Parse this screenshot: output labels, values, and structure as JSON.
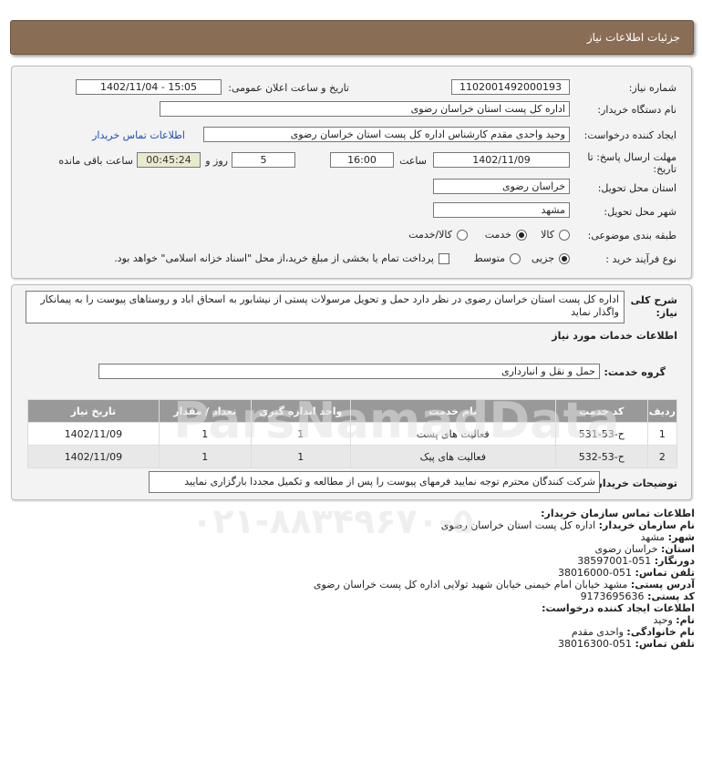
{
  "header": {
    "title": "جزئیات اطلاعات نیاز"
  },
  "fields": {
    "need_number_label": "شماره نیاز:",
    "need_number": "1102001492000193",
    "announce_label": "تاریخ و ساعت اعلان عمومی:",
    "announce_value": "1402/11/04 - 15:05",
    "buyer_label": "نام دستگاه خریدار:",
    "buyer_value": "اداره کل پست استان خراسان رضوی",
    "creator_label": "ایجاد کننده درخواست:",
    "creator_value": "وحید واحدی مقدم کارشناس اداره کل پست استان خراسان رضوی",
    "contact_link": "اطلاعات تماس خریدار",
    "deadline_label_1": "مهلت ارسال پاسخ: تا",
    "deadline_label_2": "تاریخ:",
    "deadline_date": "1402/11/09",
    "time_label": "ساعت",
    "deadline_time": "16:00",
    "days_value": "5",
    "days_label": "روز و",
    "remaining_time": "00:45:24",
    "remaining_label": "ساعت باقی مانده",
    "province_label": "استان محل تحویل:",
    "province_value": "خراسان رضوی",
    "city_label": "شهر محل تحویل:",
    "city_value": "مشهد",
    "category_label": "طبقه بندی موضوعی:",
    "cat_goods": "کالا",
    "cat_service": "خدمت",
    "cat_both": "کالا/خدمت",
    "process_label": "نوع فرآیند خرید :",
    "proc_partial": "جزیی",
    "proc_medium": "متوسط",
    "payment_note": "پرداخت تمام یا بخشی از مبلغ خرید،از محل \"اسناد خزانه اسلامی\" خواهد بود."
  },
  "summary": {
    "label_1": "شرح کلی",
    "label_2": "نیاز:",
    "text": "اداره کل پست استان خراسان رضوی در نظر دارد حمل و تحویل مرسولات پستی از نیشابور به اسحاق اباد و روستاهای پیوست را به پیمانکار واگذار نماید"
  },
  "services": {
    "section_title": "اطلاعات خدمات مورد نیاز",
    "group_label": "گروه خدمت:",
    "group_value": "حمل و نقل و انبارداری",
    "columns": [
      "ردیف",
      "کد خدمت",
      "نام خدمت",
      "واحد اندازه گیری",
      "تعداد / مقدار",
      "تاریخ نیاز"
    ],
    "rows": [
      {
        "row": "1",
        "code": "ح-53-531",
        "name": "فعالیت های پست",
        "unit": "1",
        "qty": "1",
        "date": "1402/11/09"
      },
      {
        "row": "2",
        "code": "ح-53-532",
        "name": "فعالیت های پیک",
        "unit": "1",
        "qty": "1",
        "date": "1402/11/09"
      }
    ],
    "notes_label": "توضیحات خریدار:",
    "notes_value": "شرکت کنندگان محترم توجه نمایید فرمهای پیوست را پس از مطالعه و تکمیل مجددا بارگزاری نمایید"
  },
  "contact": {
    "title": "اطلاعات تماس سازمان خریدار:",
    "org_label": "نام سازمان خریدار:",
    "org_value": "اداره کل پست استان خراسان رضوی",
    "city_label": "شهر:",
    "city_value": "مشهد",
    "province_label": "استان:",
    "province_value": "خراسان رضوی",
    "fax_label": "دورنگار:",
    "fax_value": "051-38597001",
    "phone_label": "تلفن تماس:",
    "phone_value": "051-38016000",
    "address_label": "آدرس پستی:",
    "address_value": "مشهد خیابان امام خیمنی خیابان شهید تولایی اداره کل پست خراسان رضوی",
    "postal_label": "کد پستی:",
    "postal_value": "9173695636",
    "creator_title": "اطلاعات ایجاد کننده درخواست:",
    "name_label": "نام:",
    "name_value": "وحید",
    "family_label": "نام خانوادگی:",
    "family_value": "واحدی مقدم",
    "cphone_label": "تلفن تماس:",
    "cphone_value": "051-38016300"
  },
  "watermark": {
    "brand": "ParsNamadData",
    "phone": "۰۲۱-۸۸۳۴۹۶۷۰-۵"
  }
}
